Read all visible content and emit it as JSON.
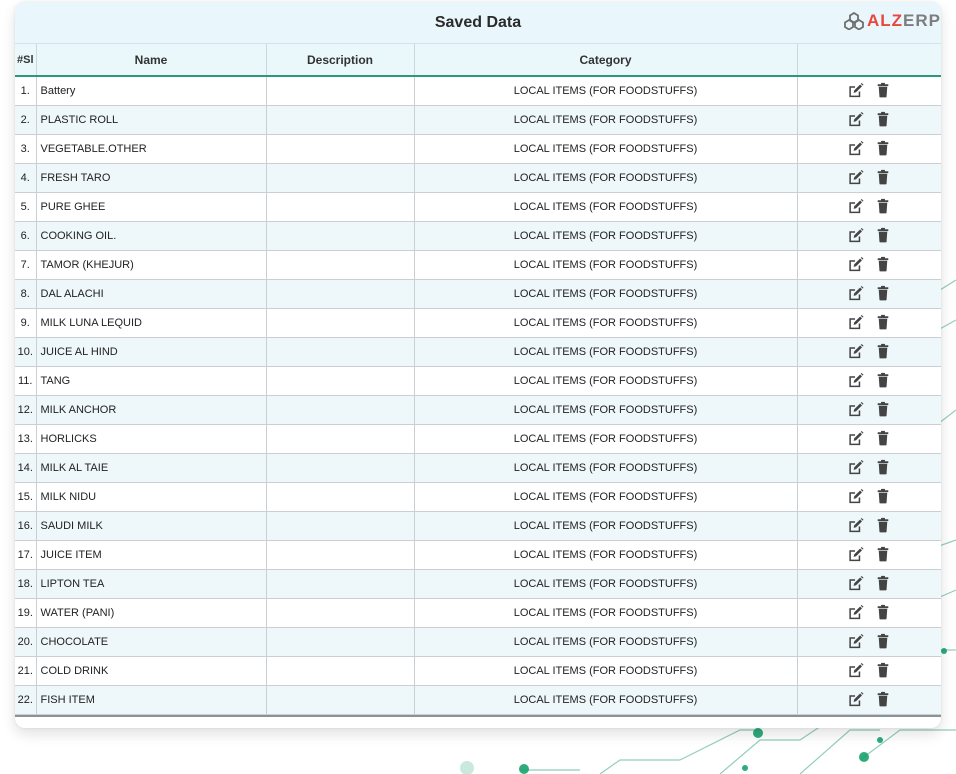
{
  "header": {
    "title": "Saved Data",
    "brand_a": "ALZ",
    "brand_b": "ERP"
  },
  "table": {
    "columns": [
      "#Sl",
      "Name",
      "Description",
      "Category",
      ""
    ],
    "rows": [
      {
        "sl": "1.",
        "name": "Battery",
        "description": "",
        "category": "LOCAL ITEMS (FOR FOODSTUFFS)"
      },
      {
        "sl": "2.",
        "name": "PLASTIC ROLL",
        "description": "",
        "category": "LOCAL ITEMS (FOR FOODSTUFFS)"
      },
      {
        "sl": "3.",
        "name": "VEGETABLE.OTHER",
        "description": "",
        "category": "LOCAL ITEMS (FOR FOODSTUFFS)"
      },
      {
        "sl": "4.",
        "name": "FRESH TARO",
        "description": "",
        "category": "LOCAL ITEMS (FOR FOODSTUFFS)"
      },
      {
        "sl": "5.",
        "name": "PURE GHEE",
        "description": "",
        "category": "LOCAL ITEMS (FOR FOODSTUFFS)"
      },
      {
        "sl": "6.",
        "name": "COOKING OIL.",
        "description": "",
        "category": "LOCAL ITEMS (FOR FOODSTUFFS)"
      },
      {
        "sl": "7.",
        "name": "TAMOR (KHEJUR)",
        "description": "",
        "category": "LOCAL ITEMS (FOR FOODSTUFFS)"
      },
      {
        "sl": "8.",
        "name": "DAL ALACHI",
        "description": "",
        "category": "LOCAL ITEMS (FOR FOODSTUFFS)"
      },
      {
        "sl": "9.",
        "name": "MILK LUNA LEQUID",
        "description": "",
        "category": "LOCAL ITEMS (FOR FOODSTUFFS)"
      },
      {
        "sl": "10.",
        "name": "JUICE AL HIND",
        "description": "",
        "category": "LOCAL ITEMS (FOR FOODSTUFFS)"
      },
      {
        "sl": "11.",
        "name": "TANG",
        "description": "",
        "category": "LOCAL ITEMS (FOR FOODSTUFFS)"
      },
      {
        "sl": "12.",
        "name": "MILK ANCHOR",
        "description": "",
        "category": "LOCAL ITEMS (FOR FOODSTUFFS)"
      },
      {
        "sl": "13.",
        "name": "HORLICKS",
        "description": "",
        "category": "LOCAL ITEMS (FOR FOODSTUFFS)"
      },
      {
        "sl": "14.",
        "name": "MILK AL TAIE",
        "description": "",
        "category": "LOCAL ITEMS (FOR FOODSTUFFS)"
      },
      {
        "sl": "15.",
        "name": "MILK NIDU",
        "description": "",
        "category": "LOCAL ITEMS (FOR FOODSTUFFS)"
      },
      {
        "sl": "16.",
        "name": "SAUDI MILK",
        "description": "",
        "category": "LOCAL ITEMS (FOR FOODSTUFFS)"
      },
      {
        "sl": "17.",
        "name": "JUICE ITEM",
        "description": "",
        "category": "LOCAL ITEMS (FOR FOODSTUFFS)"
      },
      {
        "sl": "18.",
        "name": "LIPTON TEA",
        "description": "",
        "category": "LOCAL ITEMS (FOR FOODSTUFFS)"
      },
      {
        "sl": "19.",
        "name": "WATER (PANI)",
        "description": "",
        "category": "LOCAL ITEMS (FOR FOODSTUFFS)"
      },
      {
        "sl": "20.",
        "name": "CHOCOLATE",
        "description": "",
        "category": "LOCAL ITEMS (FOR FOODSTUFFS)"
      },
      {
        "sl": "21.",
        "name": "COLD DRINK",
        "description": "",
        "category": "LOCAL ITEMS (FOR FOODSTUFFS)"
      },
      {
        "sl": "22.",
        "name": "FISH ITEM",
        "description": "",
        "category": "LOCAL ITEMS (FOR FOODSTUFFS)"
      }
    ],
    "row_actions": [
      {
        "icon": "edit-icon",
        "label": "Edit"
      },
      {
        "icon": "trash-icon",
        "label": "Delete"
      }
    ]
  },
  "colors": {
    "header_bg": "#e9f6fb",
    "row_alt": "#eef7f9",
    "header_rule": "#2a9a7a",
    "brand_red": "#e8473d",
    "icon": "#444444"
  }
}
